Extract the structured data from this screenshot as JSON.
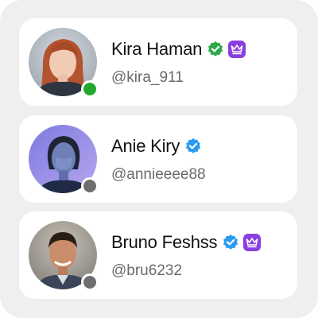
{
  "colors": {
    "online": "#22a82e",
    "offline": "#6e6e6e",
    "verified_green": "#2ea84a",
    "verified_blue": "#2a9cf0",
    "premium_purple": "#8b3fe0"
  },
  "users": [
    {
      "name": "Kira Haman",
      "handle": "@kira_911",
      "status": "online",
      "verified_icon": "green-verified-badge-icon",
      "premium": true
    },
    {
      "name": "Anie Kiry",
      "handle": "@annieeee88",
      "status": "offline",
      "verified_icon": "blue-verified-badge-icon",
      "premium": false
    },
    {
      "name": "Bruno Feshss",
      "handle": "@bru6232",
      "status": "offline",
      "verified_icon": "blue-verified-badge-icon",
      "premium": true
    }
  ]
}
